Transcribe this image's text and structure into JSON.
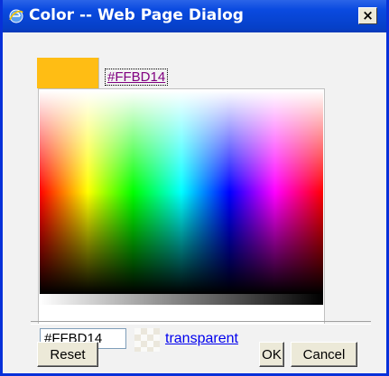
{
  "window": {
    "title": "Color -- Web Page Dialog",
    "close_label": "×"
  },
  "colors": {
    "selected": "#FFBD14",
    "titlebar": "#0A4AE0"
  },
  "color_picker": {
    "hex_link": "#FFBD14",
    "hex_input_value": "#FFBD14",
    "transparent_label": "transparent"
  },
  "buttons": {
    "reset": "Reset",
    "ok": "OK",
    "cancel": "Cancel"
  },
  "icons": {
    "app": "ie-icon",
    "close": "close-icon"
  }
}
